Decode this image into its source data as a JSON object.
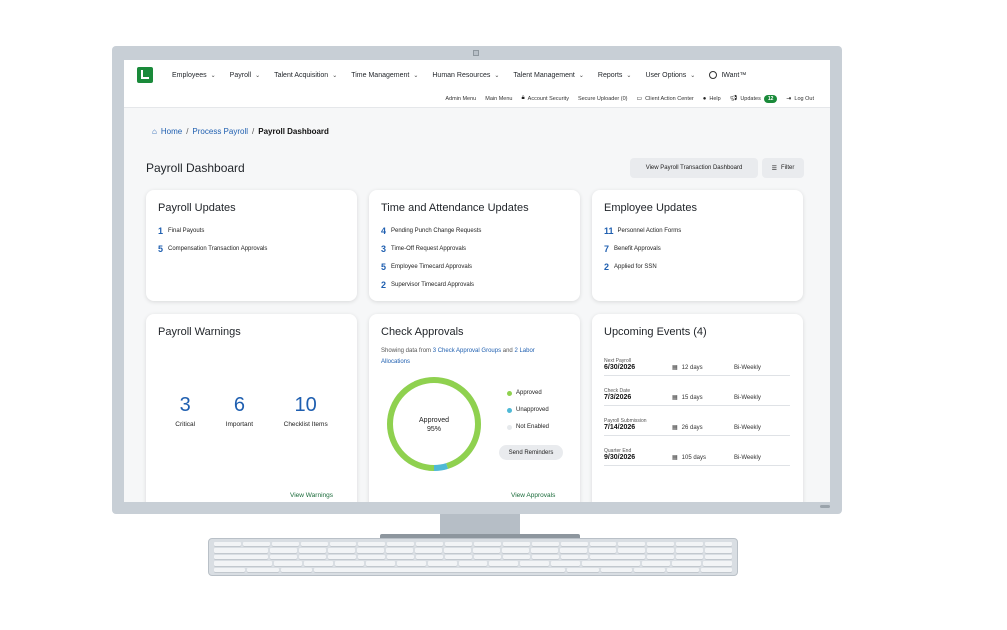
{
  "nav": {
    "items": [
      {
        "label": "Employees"
      },
      {
        "label": "Payroll"
      },
      {
        "label": "Talent Acquisition"
      },
      {
        "label": "Time Management"
      },
      {
        "label": "Human Resources"
      },
      {
        "label": "Talent Management"
      },
      {
        "label": "Reports"
      },
      {
        "label": "User Options"
      }
    ],
    "iwant": "IWant™"
  },
  "subnav": {
    "admin_menu": "Admin Menu",
    "main_menu": "Main Menu",
    "account_security": "Account Security",
    "secure_uploader": "Secure Uploader (0)",
    "client_action_center": "Client Action Center",
    "help": "Help",
    "updates": "Updates",
    "updates_count": "12",
    "log_out": "Log Out"
  },
  "breadcrumb": {
    "home": "Home",
    "process_payroll": "Process Payroll",
    "current": "Payroll Dashboard",
    "sep": "/"
  },
  "page": {
    "title": "Payroll Dashboard",
    "view_dashboard_button": "View Payroll Transaction Dashboard",
    "filter_button": "Filter"
  },
  "payroll_updates": {
    "title": "Payroll Updates",
    "items": [
      {
        "count": "1",
        "label": "Final Payouts"
      },
      {
        "count": "5",
        "label": "Compensation Transaction Approvals"
      }
    ]
  },
  "time_updates": {
    "title": "Time and Attendance Updates",
    "items": [
      {
        "count": "4",
        "label": "Pending Punch Change Requests"
      },
      {
        "count": "3",
        "label": "Time-Off Request Approvals"
      },
      {
        "count": "5",
        "label": "Employee Timecard Approvals"
      },
      {
        "count": "2",
        "label": "Supervisor Timecard Approvals"
      }
    ]
  },
  "employee_updates": {
    "title": "Employee Updates",
    "items": [
      {
        "count": "11",
        "label": "Personnel Action Forms"
      },
      {
        "count": "7",
        "label": "Benefit Approvals"
      },
      {
        "count": "2",
        "label": "Applied for SSN"
      }
    ]
  },
  "payroll_warnings": {
    "title": "Payroll Warnings",
    "stats": [
      {
        "value": "3",
        "label": "Critical"
      },
      {
        "value": "6",
        "label": "Important"
      },
      {
        "value": "10",
        "label": "Checklist Items"
      }
    ],
    "link": "View Warnings"
  },
  "check_approvals": {
    "title": "Check Approvals",
    "desc_prefix": "Showing data from",
    "groups_link": "3 Check Approval Groups",
    "desc_and": "and",
    "allocations_link": "2 Labor Allocations",
    "donut_label": "Approved",
    "donut_value": "95%",
    "approved_fraction": 0.95,
    "legend": [
      {
        "label": "Approved",
        "color": "#8fd14f"
      },
      {
        "label": "Unapproved",
        "color": "#4fb9d6"
      },
      {
        "label": "Not Enabled",
        "color": "#e6e9ec"
      }
    ],
    "send_reminders": "Send Reminders",
    "link": "View Approvals"
  },
  "upcoming_events": {
    "title": "Upcoming Events (4)",
    "events": [
      {
        "label": "Next Payroll",
        "date": "6/30/2026",
        "days": "12 days",
        "freq": "Bi-Weekly"
      },
      {
        "label": "Check Date",
        "date": "7/3/2026",
        "days": "15 days",
        "freq": "Bi-Weekly"
      },
      {
        "label": "Payroll Submission",
        "date": "7/14/2026",
        "days": "26 days",
        "freq": "Bi-Weekly"
      },
      {
        "label": "Quarter End",
        "date": "9/30/2026",
        "days": "105 days",
        "freq": "Bi-Weekly"
      }
    ]
  },
  "colors": {
    "brand": "#1a8a3a",
    "link": "#1f5fb0"
  }
}
